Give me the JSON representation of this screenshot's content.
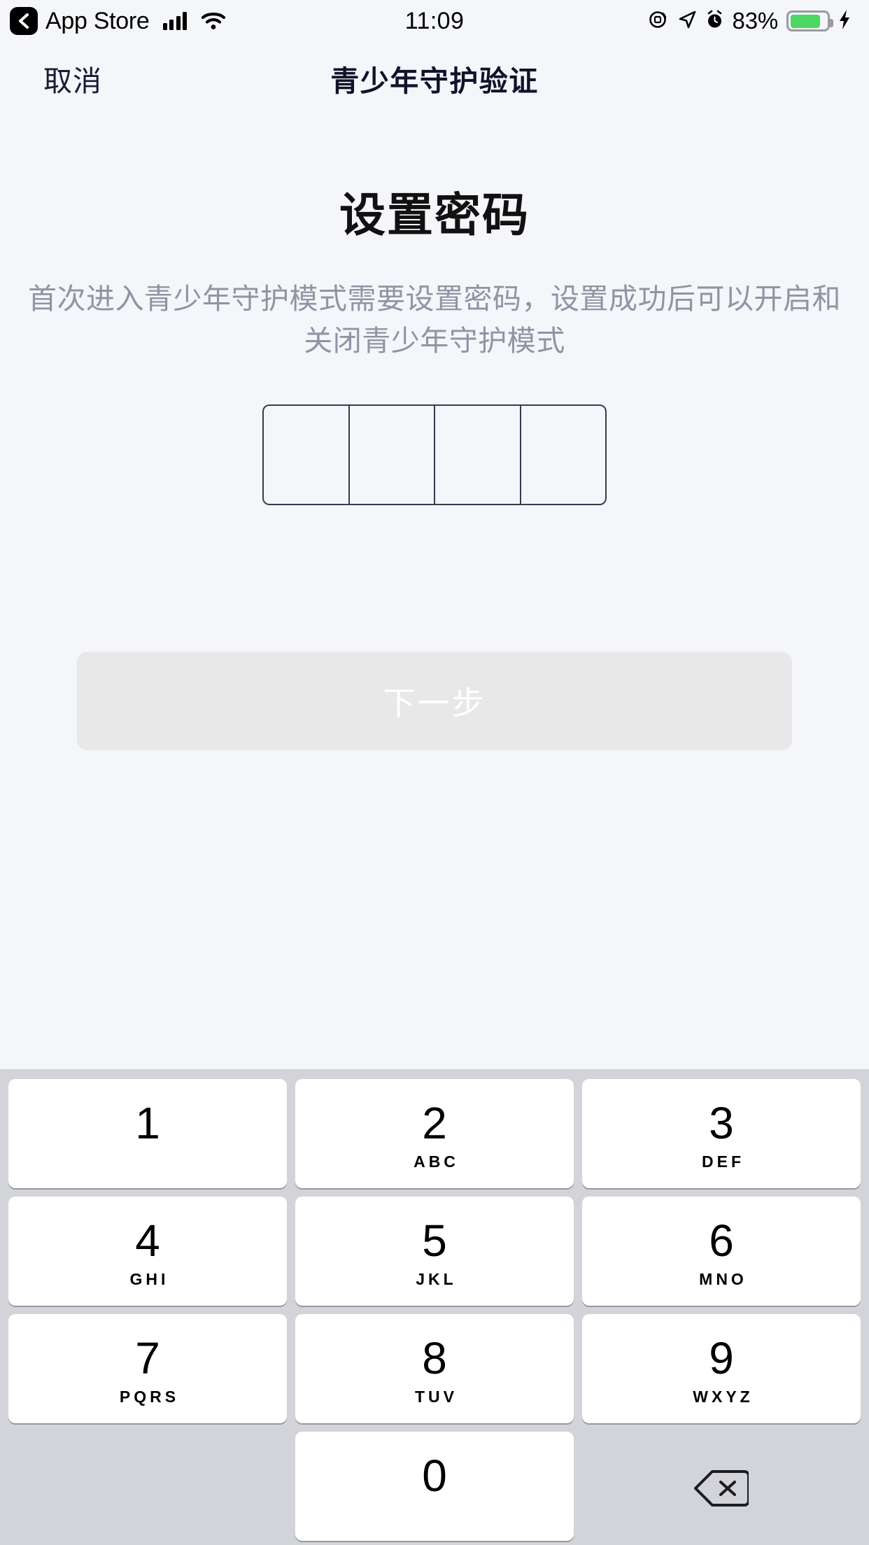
{
  "status_bar": {
    "back_label": "App Store",
    "back_icon": "chevron-left-icon",
    "signal_icon": "cellular-signal-icon",
    "wifi_icon": "wifi-icon",
    "time": "11:09",
    "rotation_lock_icon": "rotation-lock-icon",
    "location_icon": "location-arrow-icon",
    "alarm_icon": "alarm-clock-icon",
    "battery_percent": "83%",
    "battery_level": 83,
    "battery_icon": "battery-icon",
    "charging_icon": "lightning-bolt-icon",
    "battery_color": "#4cd763"
  },
  "nav": {
    "cancel_label": "取消",
    "title": "青少年守护验证"
  },
  "main": {
    "page_title": "设置密码",
    "description": "首次进入青少年守护模式需要设置密码，设置成功后可以开启和关闭青少年守护模式",
    "pin": {
      "length": 4,
      "values": [
        "",
        "",
        "",
        ""
      ]
    },
    "next_button": {
      "label": "下一步",
      "enabled": false,
      "bg_color": "#e8e8e8",
      "text_color": "#ffffff"
    }
  },
  "keypad": {
    "background_color": "#d2d4da",
    "key_color": "#ffffff",
    "rows": [
      [
        {
          "digit": "1",
          "letters": ""
        },
        {
          "digit": "2",
          "letters": "ABC"
        },
        {
          "digit": "3",
          "letters": "DEF"
        }
      ],
      [
        {
          "digit": "4",
          "letters": "GHI"
        },
        {
          "digit": "5",
          "letters": "JKL"
        },
        {
          "digit": "6",
          "letters": "MNO"
        }
      ],
      [
        {
          "digit": "7",
          "letters": "PQRS"
        },
        {
          "digit": "8",
          "letters": "TUV"
        },
        {
          "digit": "9",
          "letters": "WXYZ"
        }
      ],
      [
        {
          "digit": "",
          "letters": "",
          "type": "blank"
        },
        {
          "digit": "0",
          "letters": ""
        },
        {
          "digit": "",
          "letters": "",
          "type": "delete",
          "icon": "delete-backspace-icon"
        }
      ]
    ]
  }
}
